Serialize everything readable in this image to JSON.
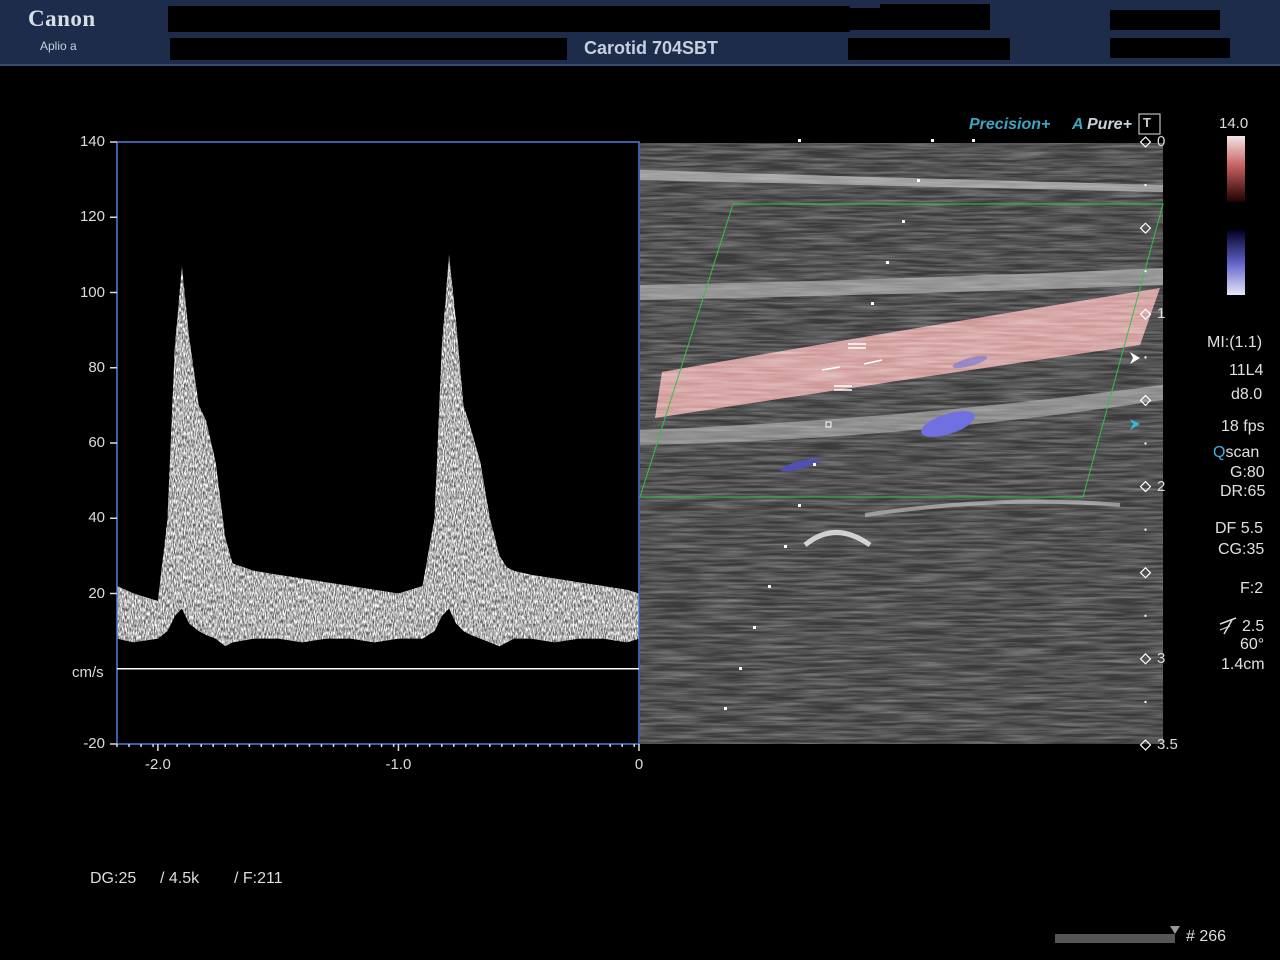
{
  "header": {
    "brand": "Canon",
    "model": "Aplio a",
    "probe_preset": "Carotid 704SBT"
  },
  "image_panel": {
    "indicators": {
      "precision": "Precision+",
      "pure_a": "A",
      "pure": "Pure+",
      "t_icon": "T"
    },
    "depth_marks": [
      "0",
      "1",
      "2",
      "3",
      "3.5"
    ],
    "depth_values": [
      0,
      1,
      2,
      3,
      3.5
    ],
    "color_scale": {
      "top": "14.0",
      "pos_color": "#e8b0b0",
      "neg_color": "#7f7fe0"
    }
  },
  "params": {
    "mi": "MI:(1.1)",
    "transducer": "11L4",
    "depth": "d8.0",
    "fps": "18 fps",
    "qscan_q": "Q",
    "qscan_rest": "scan",
    "gain": "G:80",
    "dr": "DR:65",
    "df": "DF 5.5",
    "cg": "CG:35",
    "filter": "F:2",
    "angle_val": "2.5",
    "angle": "60°",
    "gate": "1.4cm"
  },
  "doppler": {
    "unit": "cm/s",
    "y_ticks": [
      "140",
      "120",
      "100",
      "80",
      "60",
      "40",
      "20",
      "-20"
    ],
    "y_values": [
      140,
      120,
      100,
      80,
      60,
      40,
      20,
      -20
    ],
    "y_range": [
      -20,
      140
    ],
    "x_ticks": [
      "-2.0",
      "-1.0",
      "0"
    ],
    "x_values": [
      -2.0,
      -1.0,
      0
    ],
    "x_range": [
      -2.17,
      0
    ],
    "waveform": {
      "t": [
        -2.17,
        -2.1,
        -2.0,
        -1.96,
        -1.93,
        -1.9,
        -1.87,
        -1.83,
        -1.8,
        -1.76,
        -1.72,
        -1.69,
        -1.6,
        -1.5,
        -1.4,
        -1.3,
        -1.2,
        -1.1,
        -1.0,
        -0.9,
        -0.85,
        -0.82,
        -0.79,
        -0.76,
        -0.73,
        -0.7,
        -0.66,
        -0.62,
        -0.58,
        -0.55,
        -0.52,
        -0.45,
        -0.35,
        -0.25,
        -0.15,
        -0.05,
        0
      ],
      "peak": [
        22,
        20,
        18,
        40,
        85,
        107,
        88,
        70,
        66,
        55,
        35,
        28,
        26,
        25,
        24,
        23,
        22,
        21,
        20,
        22,
        40,
        85,
        110,
        92,
        70,
        64,
        55,
        40,
        30,
        27,
        26,
        25,
        24,
        23,
        22,
        21,
        20
      ],
      "base": [
        8,
        7,
        8,
        10,
        14,
        16,
        12,
        10,
        9,
        8,
        6,
        7,
        8,
        8,
        7,
        8,
        8,
        7,
        8,
        8,
        10,
        14,
        16,
        12,
        10,
        9,
        8,
        7,
        6,
        7,
        8,
        8,
        7,
        8,
        8,
        7,
        8
      ]
    }
  },
  "footer": {
    "dg": "DG:25",
    "prf": "/ 4.5k",
    "frame_f": "/ F:211",
    "frame_no": "# 266"
  }
}
